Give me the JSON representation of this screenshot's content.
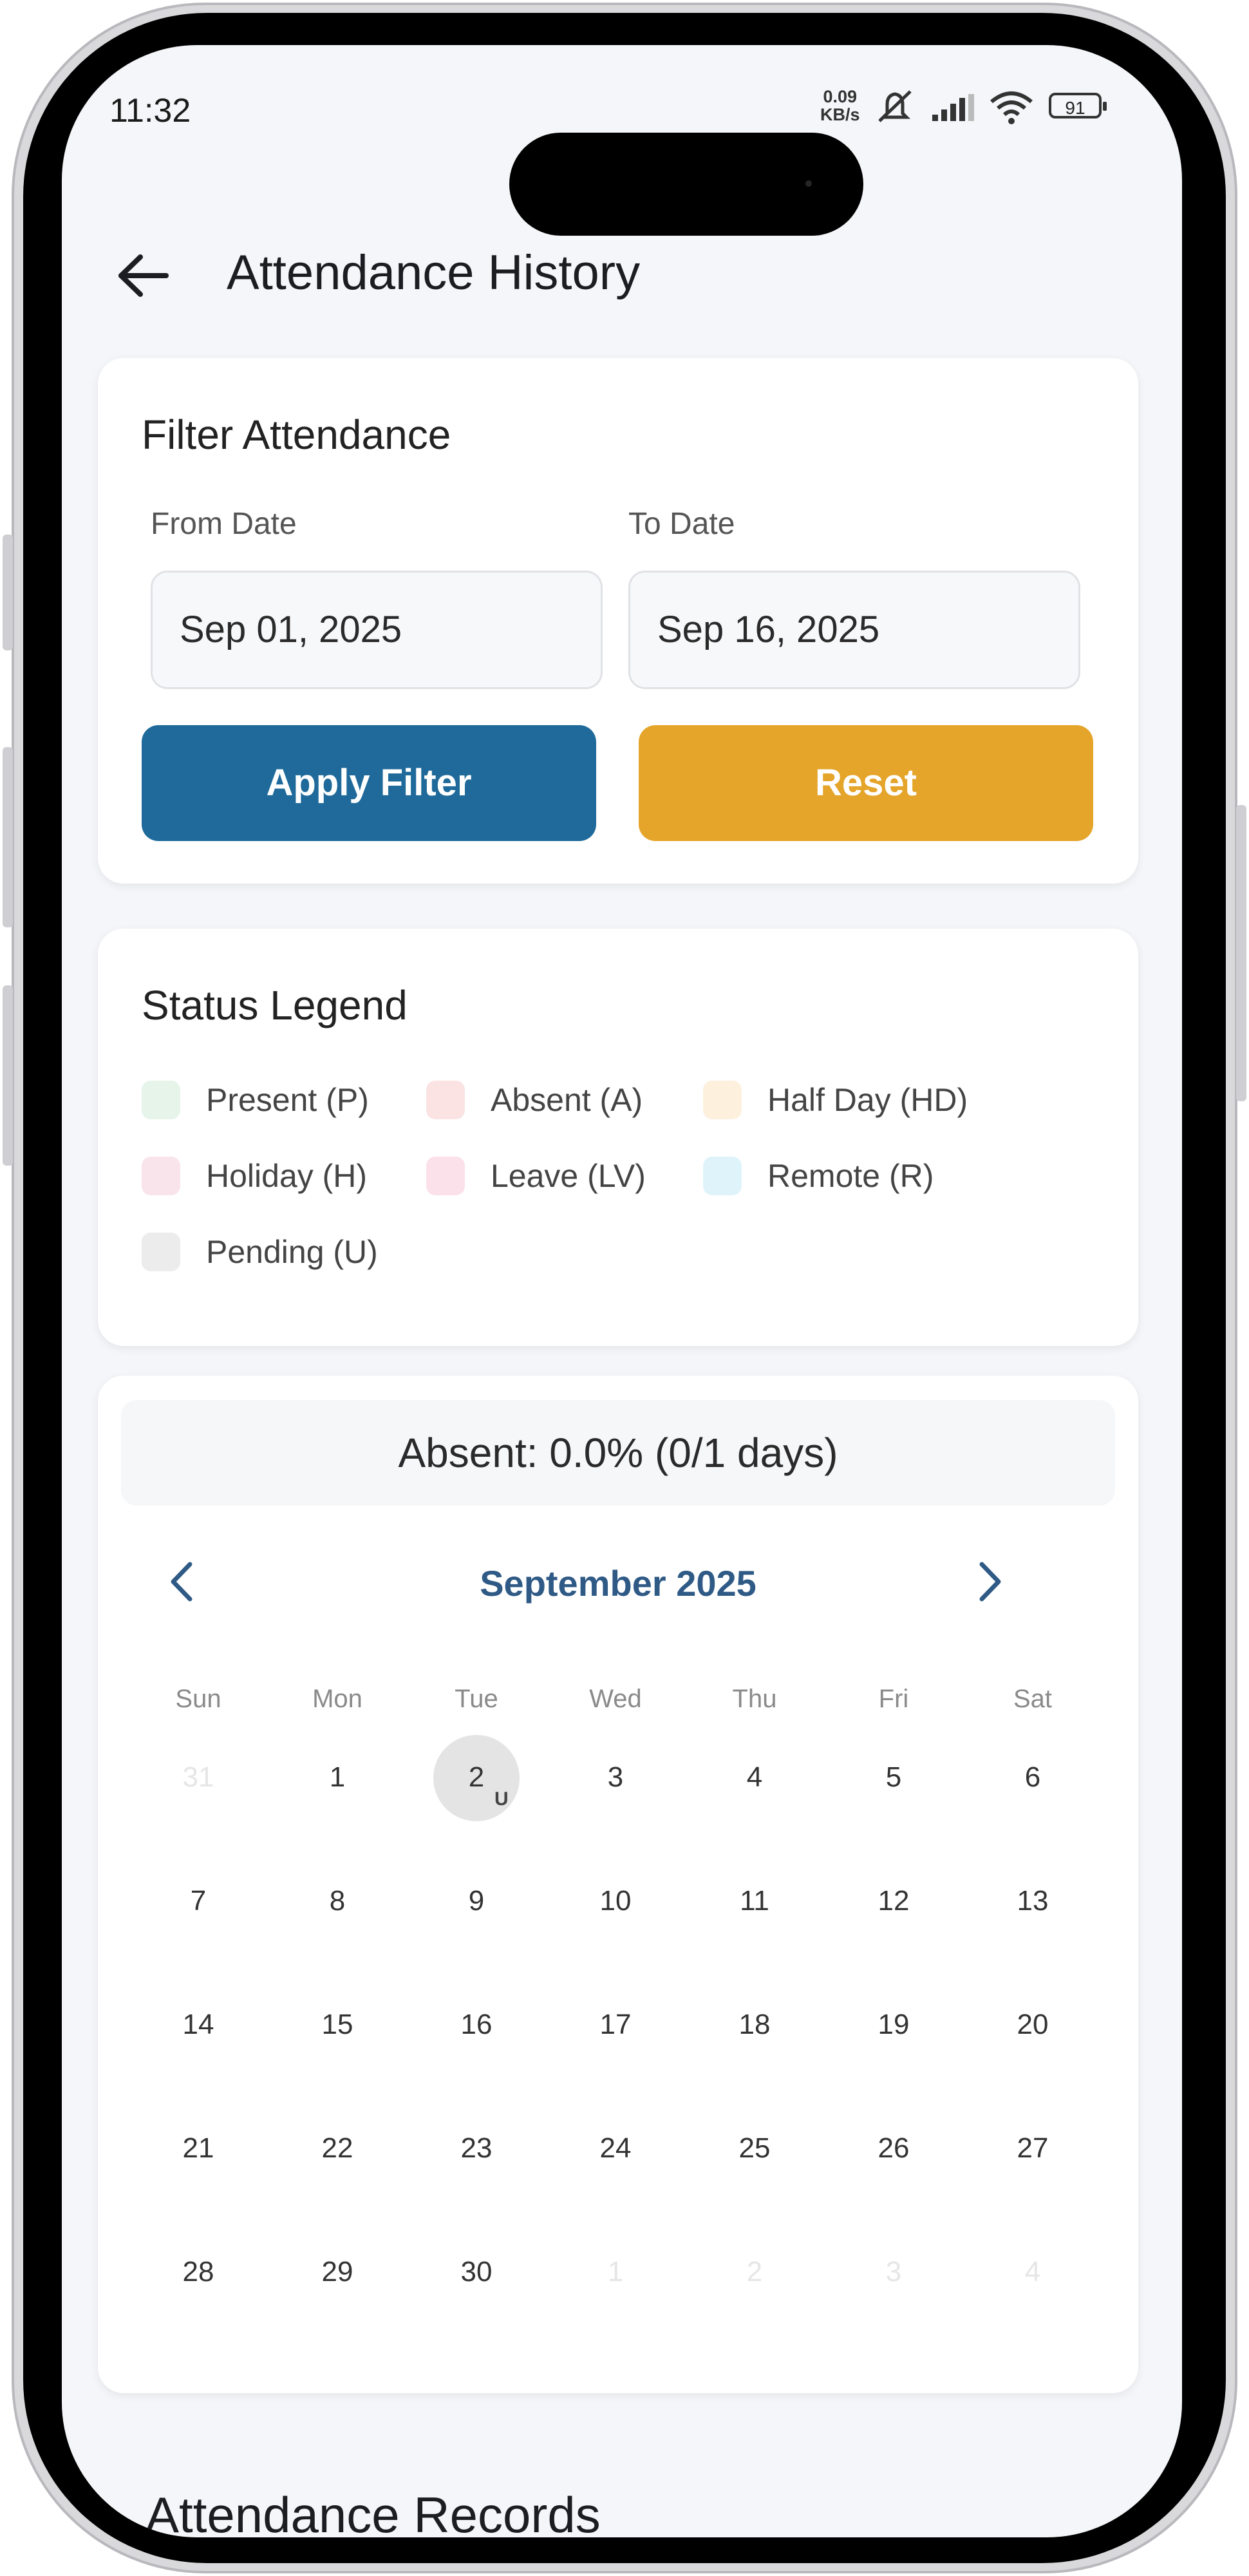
{
  "status_bar": {
    "time": "11:32",
    "net_speed_value": "0.09",
    "net_speed_unit": "KB/s",
    "battery": "91",
    "icons": [
      "mute-icon",
      "signal-icon",
      "wifi-icon",
      "battery-icon"
    ]
  },
  "header": {
    "title": "Attendance History",
    "back_icon": "arrow-left-icon"
  },
  "filter": {
    "title": "Filter Attendance",
    "from_label": "From Date",
    "from_value": "Sep 01, 2025",
    "to_label": "To Date",
    "to_value": "Sep 16, 2025",
    "apply_label": "Apply Filter",
    "reset_label": "Reset",
    "apply_color": "#1f6a9a",
    "reset_color": "#e5a42a"
  },
  "legend": {
    "title": "Status Legend",
    "items": [
      {
        "label": "Present (P)",
        "color": "#e6f4ea"
      },
      {
        "label": "Absent (A)",
        "color": "#fbe3e4"
      },
      {
        "label": "Half Day (HD)",
        "color": "#fdf1de"
      },
      {
        "label": "Holiday (H)",
        "color": "#f9e4ec"
      },
      {
        "label": "Leave (LV)",
        "color": "#fbe1ea"
      },
      {
        "label": "Remote (R)",
        "color": "#dff4fa"
      },
      {
        "label": "Pending (U)",
        "color": "#ececec"
      }
    ]
  },
  "calendar": {
    "summary": "Absent: 0.0% (0/1 days)",
    "month": "September 2025",
    "prev_icon": "chevron-left-icon",
    "next_icon": "chevron-right-icon",
    "weekdays": [
      "Sun",
      "Mon",
      "Tue",
      "Wed",
      "Thu",
      "Fri",
      "Sat"
    ],
    "weeks": [
      [
        "31",
        "1",
        "2",
        "3",
        "4",
        "5",
        "6"
      ],
      [
        "7",
        "8",
        "9",
        "10",
        "11",
        "12",
        "13"
      ],
      [
        "14",
        "15",
        "16",
        "17",
        "18",
        "19",
        "20"
      ],
      [
        "21",
        "22",
        "23",
        "24",
        "25",
        "26",
        "27"
      ],
      [
        "28",
        "29",
        "30",
        "1",
        "2",
        "3",
        "4"
      ]
    ],
    "selected_day": "2",
    "selected_status": "U",
    "accent_color": "#2f5a86"
  },
  "records": {
    "title": "Attendance Records"
  }
}
